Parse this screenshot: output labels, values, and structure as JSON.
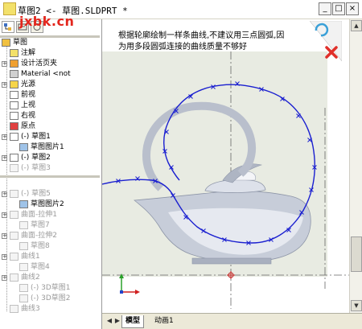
{
  "window": {
    "title": "草图2 <- 草图.SLDPRT *",
    "watermark": "jxbk.cn",
    "minimize": "_",
    "maximize": "□",
    "close": "×"
  },
  "feature_tree": {
    "items": [
      {
        "label": "草图",
        "state": "normal",
        "icon": "part-icon"
      },
      {
        "label": "注解",
        "state": "normal",
        "icon": "annotation-icon"
      },
      {
        "label": "设计活页夹",
        "state": "normal",
        "icon": "binder-icon"
      },
      {
        "label": "Material <not",
        "state": "normal",
        "icon": "material-icon"
      },
      {
        "label": "光源",
        "state": "normal",
        "icon": "light-icon"
      },
      {
        "label": "前视",
        "state": "normal",
        "icon": "plane-icon"
      },
      {
        "label": "上视",
        "state": "normal",
        "icon": "plane-icon"
      },
      {
        "label": "右视",
        "state": "normal",
        "icon": "plane-icon"
      },
      {
        "label": "原点",
        "state": "normal",
        "icon": "origin-icon"
      },
      {
        "label": "(-) 草图1",
        "state": "normal",
        "icon": "sketch-icon"
      },
      {
        "label": "草图图片1",
        "state": "normal",
        "icon": "picture-icon"
      },
      {
        "label": "(-) 草图2",
        "state": "normal",
        "icon": "sketch-icon"
      },
      {
        "label": "(-) 草图3",
        "state": "grey",
        "icon": "sketch-icon"
      },
      {
        "label": "(-) 草图5",
        "state": "grey",
        "icon": "sketch-icon"
      },
      {
        "label": "草图图片2",
        "state": "normal",
        "icon": "picture-icon"
      },
      {
        "label": "曲面-拉伸1",
        "state": "grey",
        "icon": "surface-icon"
      },
      {
        "label": "草图7",
        "state": "grey",
        "icon": "sketch-icon"
      },
      {
        "label": "曲面-拉伸2",
        "state": "grey",
        "icon": "surface-icon"
      },
      {
        "label": "草图8",
        "state": "grey",
        "icon": "sketch-icon"
      },
      {
        "label": "曲线1",
        "state": "grey",
        "icon": "curve-icon"
      },
      {
        "label": "草图4",
        "state": "grey",
        "icon": "sketch-icon"
      },
      {
        "label": "曲线2",
        "state": "grey",
        "icon": "curve-icon"
      },
      {
        "label": "(-) 3D草图1",
        "state": "grey",
        "icon": "sketch3d-icon"
      },
      {
        "label": "(-) 3D草图2",
        "state": "grey",
        "icon": "sketch3d-icon"
      },
      {
        "label": "曲线3",
        "state": "grey",
        "icon": "curve-icon"
      }
    ]
  },
  "canvas": {
    "note": "根据轮廓绘制一样条曲线,不建议用三点圆弧,因为用多段圆弧连接的曲线质量不够好"
  },
  "bottom_tabs": {
    "model": "模型",
    "animation": "动画1"
  },
  "colors": {
    "spline": "#1a1fd0",
    "confirm": "#3aa0d8",
    "cancel": "#e0302a",
    "watermark": "#e3261d"
  }
}
